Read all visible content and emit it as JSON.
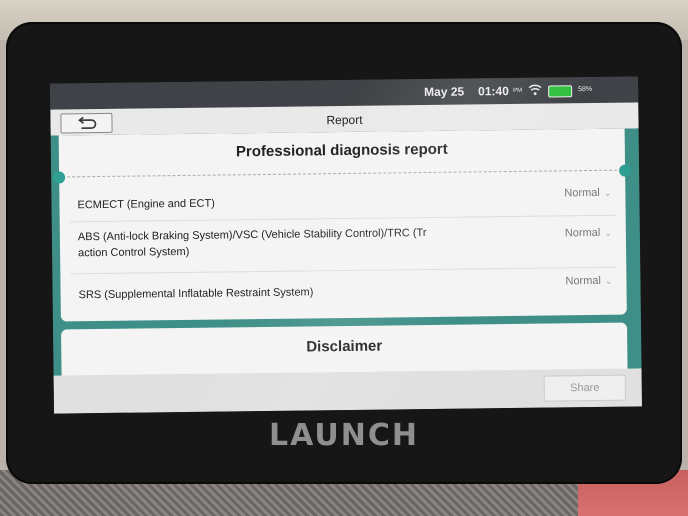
{
  "status_bar": {
    "date": "May 25",
    "time": "01:40",
    "ampm": "PM",
    "battery": "58%"
  },
  "app_bar": {
    "title": "Report"
  },
  "report": {
    "title": "Professional diagnosis report",
    "rows": [
      {
        "label": "ECMECT (Engine and ECT)",
        "status": "Normal"
      },
      {
        "label": "ABS (Anti-lock Braking System)/VSC (Vehicle Stability Control)/TRC (Tr",
        "label2": "action Control System)",
        "status": "Normal"
      },
      {
        "label": "SRS (Supplemental Inflatable Restraint System)",
        "status": "Normal"
      }
    ]
  },
  "disclaimer": {
    "title": "Disclaimer"
  },
  "footer": {
    "share_label": "Share"
  },
  "device": {
    "brand": "LAUNCH"
  },
  "icons": {
    "back": "back-arrow-icon",
    "wifi": "wifi-icon",
    "battery": "battery-icon",
    "chevron": "chevron-down-icon"
  },
  "colors": {
    "teal": "#3e8f87",
    "battery_green": "#2fbf3d"
  }
}
